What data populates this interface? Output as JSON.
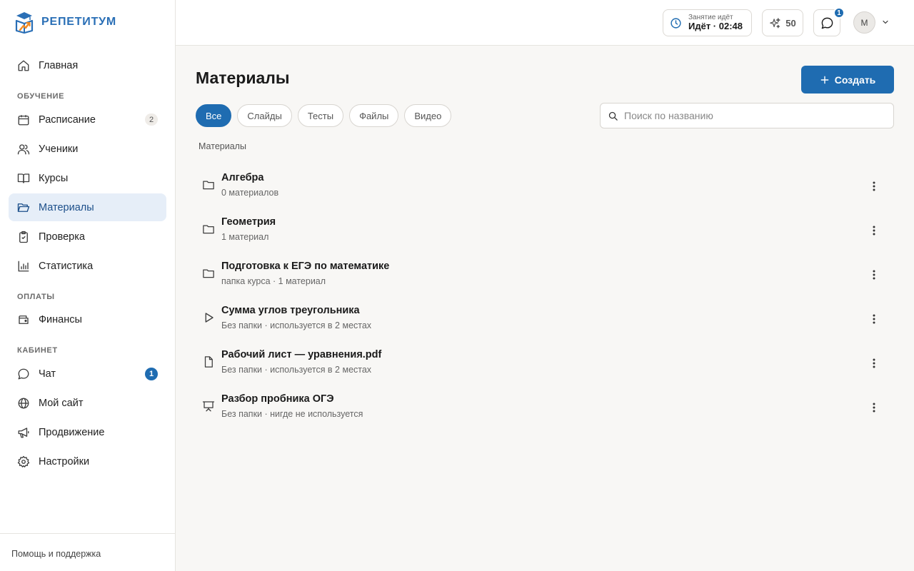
{
  "brand": {
    "name": "РЕПЕТИТУМ"
  },
  "sidebar": {
    "items": [
      {
        "label": "Главная",
        "icon": "home-icon"
      },
      {
        "label": "Расписание",
        "icon": "calendar-icon",
        "badge": "2"
      },
      {
        "label": "Ученики",
        "icon": "users-icon"
      },
      {
        "label": "Курсы",
        "icon": "book-icon"
      },
      {
        "label": "Материалы",
        "icon": "folder-open-icon",
        "active": true
      },
      {
        "label": "Проверка",
        "icon": "clipboard-check-icon"
      },
      {
        "label": "Статистика",
        "icon": "bar-chart-icon"
      },
      {
        "label": "Финансы",
        "icon": "wallet-icon"
      },
      {
        "label": "Чат",
        "icon": "chat-icon",
        "badge": "1"
      },
      {
        "label": "Мой сайт",
        "icon": "globe-icon"
      },
      {
        "label": "Продвижение",
        "icon": "megaphone-icon"
      },
      {
        "label": "Настройки",
        "icon": "gear-icon"
      }
    ],
    "sections": {
      "learning": "ОБУЧЕНИЕ",
      "payments": "ОПЛАТЫ",
      "cabinet": "КАБИНЕТ"
    },
    "footer": "Помощь и поддержка"
  },
  "topbar": {
    "session_label": "Занятие идёт",
    "session_value": "Идёт · 02:48",
    "points": "50",
    "chat_badge": "1",
    "avatar_initial": "М"
  },
  "main": {
    "title": "Материалы",
    "create_label": "Создать",
    "filters": [
      "Все",
      "Слайды",
      "Тесты",
      "Файлы",
      "Видео"
    ],
    "active_filter": "Все",
    "search_placeholder": "Поиск по названию",
    "breadcrumb": "Материалы",
    "items": [
      {
        "title": "Алгебра",
        "subtitle": "0 материалов",
        "icon": "folder-icon"
      },
      {
        "title": "Геометрия",
        "subtitle": "1 материал",
        "icon": "folder-icon"
      },
      {
        "title": "Подготовка к ЕГЭ по математике",
        "subtitle": "папка курса · 1 материал",
        "icon": "folder-icon"
      },
      {
        "title": "Сумма углов треугольника",
        "subtitle": "Без папки · используется в 2 местах",
        "icon": "play-icon"
      },
      {
        "title": "Рабочий лист — уравнения.pdf",
        "subtitle": "Без папки · используется в 2 местах",
        "icon": "file-icon"
      },
      {
        "title": "Разбор пробника ОГЭ",
        "subtitle": "Без папки · нигде не используется",
        "icon": "presentation-icon"
      }
    ]
  },
  "colors": {
    "accent": "#1f6cb1",
    "brand_blue": "#2a6fb6",
    "brand_orange": "#f08a24",
    "active_bg": "#e6eef8",
    "page_bg": "#f8f7f5"
  }
}
